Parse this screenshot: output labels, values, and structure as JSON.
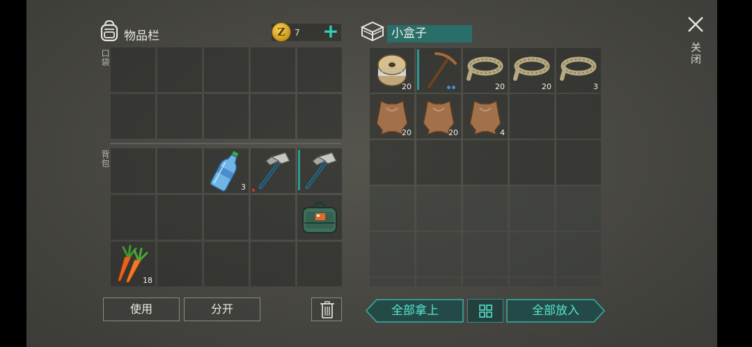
{
  "inventory": {
    "title": "物品栏",
    "coins": "7",
    "pocket_label": "口袋",
    "backpack_label": "背包"
  },
  "box": {
    "name": "小盒子"
  },
  "close_label": "关闭",
  "inventory_slots": [
    {
      "item": "water-bottle",
      "qty": "3"
    },
    {
      "item": "carrots",
      "qty": "18"
    }
  ],
  "box_slots": [
    {
      "item": "thread-spool",
      "qty": "20"
    },
    {
      "item": "rope",
      "qty": "20"
    },
    {
      "item": "rope",
      "qty": "20"
    },
    {
      "item": "rope",
      "qty": "3"
    },
    {
      "item": "leather-hide",
      "qty": "20"
    },
    {
      "item": "leather-hide",
      "qty": "20"
    },
    {
      "item": "leather-hide",
      "qty": "4"
    }
  ],
  "buttons": {
    "use": "使用",
    "split": "分开",
    "take_all": "全部拿上",
    "put_all": "全部放入"
  },
  "colors": {
    "accent": "#54e6cf",
    "box_name_bg": "#2a6e69"
  }
}
